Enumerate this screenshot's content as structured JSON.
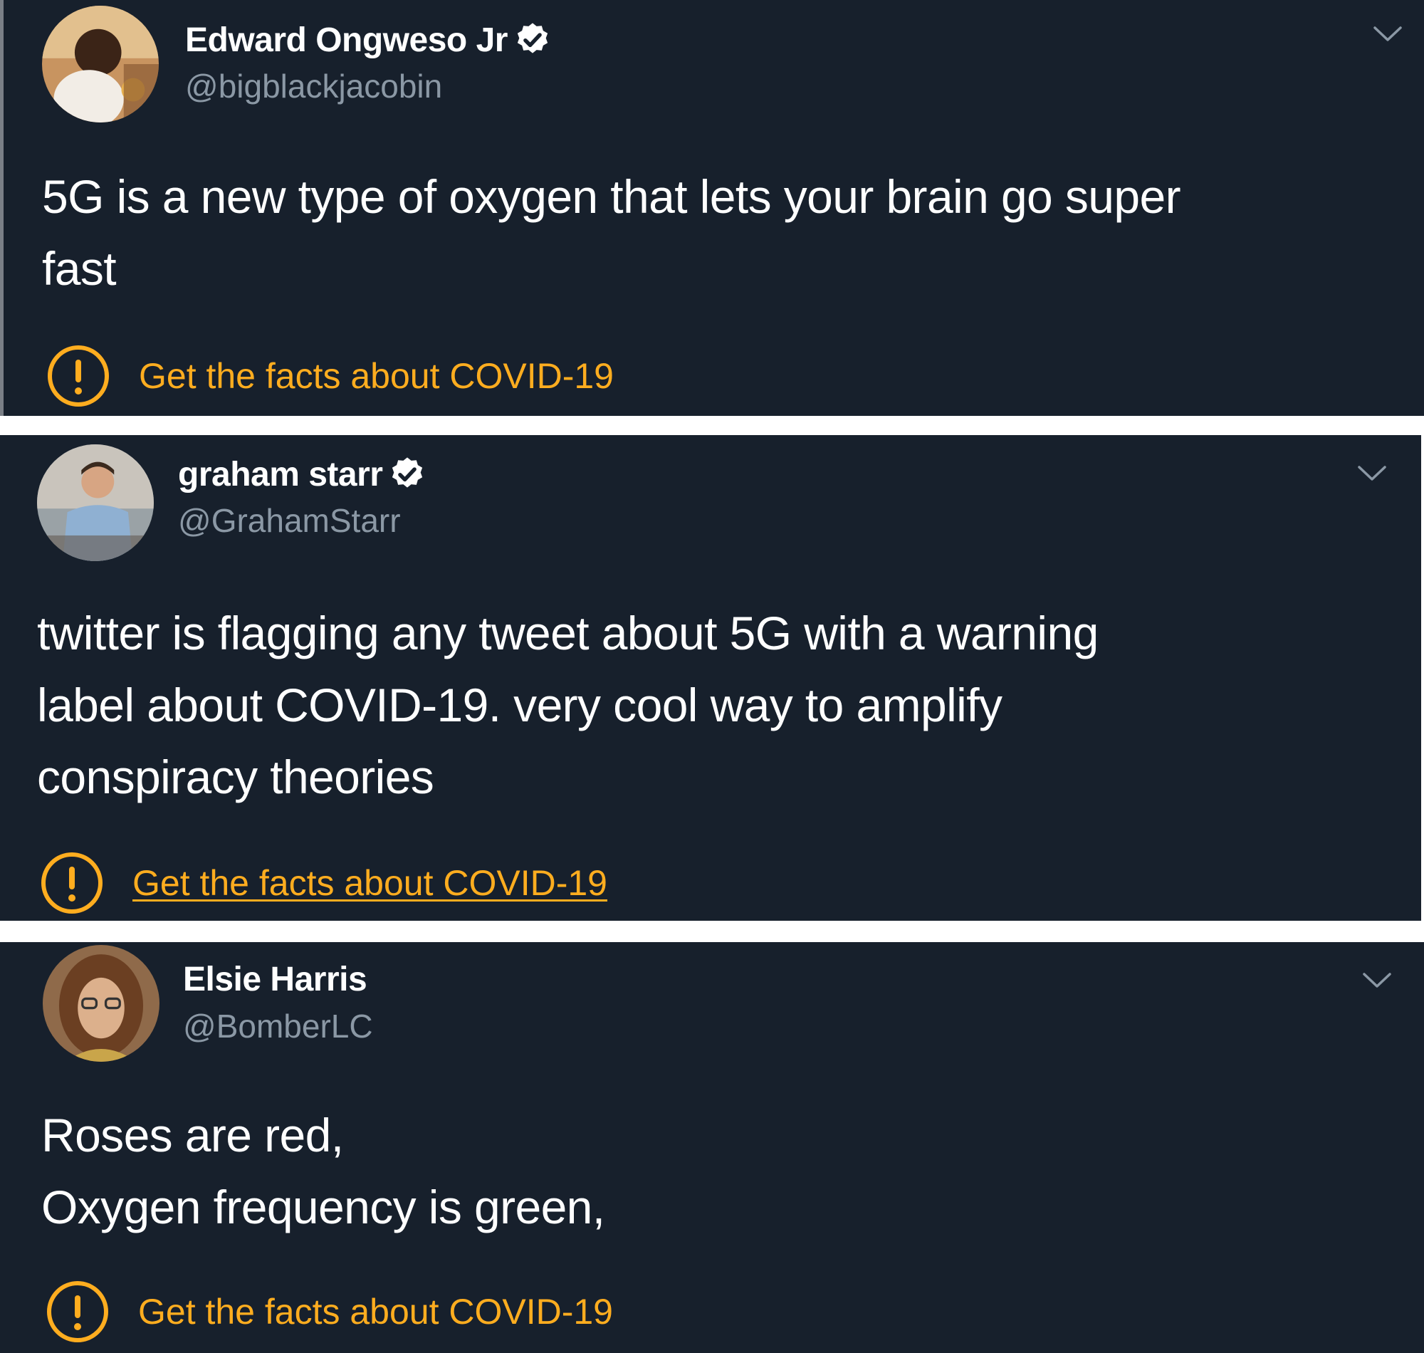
{
  "colors": {
    "background": "#17202c",
    "separator": "#ffffff",
    "text_primary": "#ffffff",
    "text_secondary": "#8b98a5",
    "warning_accent": "#ffad1f",
    "verified_badge": "#ffffff"
  },
  "tweets": [
    {
      "display_name": "Edward Ongweso Jr",
      "handle": "@bigblackjacobin",
      "verified": true,
      "avatar": "child-photo-avatar",
      "text": "5G is a new type of oxygen that lets your brain go super\nfast",
      "notice_icon": "exclamation-circle-icon",
      "notice_label": "Get the facts about COVID-19",
      "menu_icon": "chevron-down-icon"
    },
    {
      "display_name": "graham starr",
      "handle": "@GrahamStarr",
      "verified": true,
      "avatar": "man-photo-avatar",
      "text": "twitter is flagging any tweet about 5G with a warning\nlabel about COVID-19. very cool way to amplify\nconspiracy theories",
      "notice_icon": "exclamation-circle-icon",
      "notice_label": "Get the facts about COVID-19",
      "menu_icon": "chevron-down-icon"
    },
    {
      "display_name": "Elsie Harris",
      "handle": "@BomberLC",
      "verified": false,
      "avatar": "woman-photo-avatar",
      "text": "Roses are red,\nOxygen frequency is green,",
      "notice_icon": "exclamation-circle-icon",
      "notice_label": "Get the facts about COVID-19",
      "menu_icon": "chevron-down-icon"
    }
  ]
}
